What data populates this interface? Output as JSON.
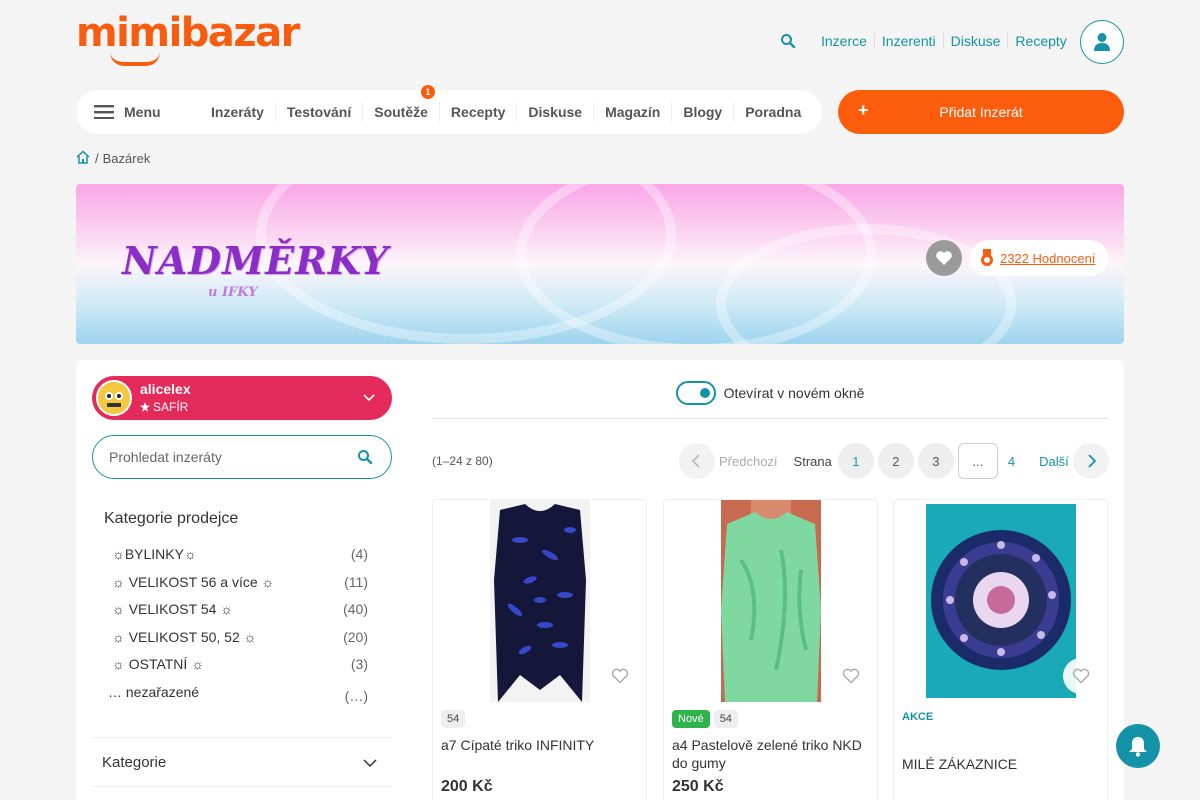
{
  "header": {
    "logo_text": "mimibazar",
    "links": [
      "Inzerce",
      "Inzerenti",
      "Diskuse",
      "Recepty"
    ]
  },
  "nav": {
    "menu_label": "Menu",
    "items": [
      {
        "label": "Inzeráty"
      },
      {
        "label": "Testování"
      },
      {
        "label": "Soutěže",
        "badge": "1"
      },
      {
        "label": "Recepty"
      },
      {
        "label": "Diskuse"
      },
      {
        "label": "Magazín"
      },
      {
        "label": "Blogy"
      },
      {
        "label": "Poradna"
      }
    ],
    "add_button_plus": "+",
    "add_button_label": "Přidat Inzerát"
  },
  "breadcrumb": {
    "separator": "/",
    "current": "Bazárek"
  },
  "banner": {
    "title": "NADMĚRKY",
    "subtitle": "u IFKY",
    "rating_link": "2322 Hodnocení"
  },
  "sidebar": {
    "seller_name": "alicelex",
    "seller_rank": "SAFÍR",
    "search_placeholder": "Prohledat inzeráty",
    "categories_title": "Kategorie prodejce",
    "categories": [
      {
        "name": "☼BYLINKY☼",
        "count": "(4)"
      },
      {
        "name": "☼ VELIKOST 56 a více ☼",
        "count": "(11)"
      },
      {
        "name": "☼ VELIKOST 54 ☼",
        "count": "(40)"
      },
      {
        "name": "☼ VELIKOST 50, 52 ☼",
        "count": "(20)"
      },
      {
        "name": "☼ OSTATNÍ ☼",
        "count": "(3)"
      },
      {
        "name": "… nezařazené",
        "count": "(…)"
      }
    ],
    "accordion_label": "Kategorie"
  },
  "content": {
    "toggle_label": "Otevírat v novém okně",
    "toggle_on": true,
    "result_count": "(1–24 z 80)",
    "pager": {
      "prev_label": "Předchozí",
      "strana_label": "Strana",
      "pages": [
        "1",
        "2",
        "3"
      ],
      "active_page": "1",
      "ellipsis": "...",
      "last_page": "4",
      "next_label": "Další"
    }
  },
  "cards": [
    {
      "tags": [
        {
          "type": "size",
          "text": "54"
        }
      ],
      "title": "a7 Cípaté triko INFINITY",
      "price": "200 Kč"
    },
    {
      "tags": [
        {
          "type": "new",
          "text": "Nové"
        },
        {
          "type": "size",
          "text": "54"
        }
      ],
      "title": "a4 Pastelově zelené triko NKD do gumy",
      "price": "250 Kč"
    },
    {
      "tags": [
        {
          "type": "akce",
          "text": "AKCE"
        }
      ],
      "title": "MILÉ ZÁKAZNICE",
      "price": ""
    }
  ],
  "colors": {
    "brand_orange": "#f85c0e",
    "accent_teal": "#1493a8",
    "seller_red": "#e32a5a",
    "new_green": "#30b34a"
  }
}
